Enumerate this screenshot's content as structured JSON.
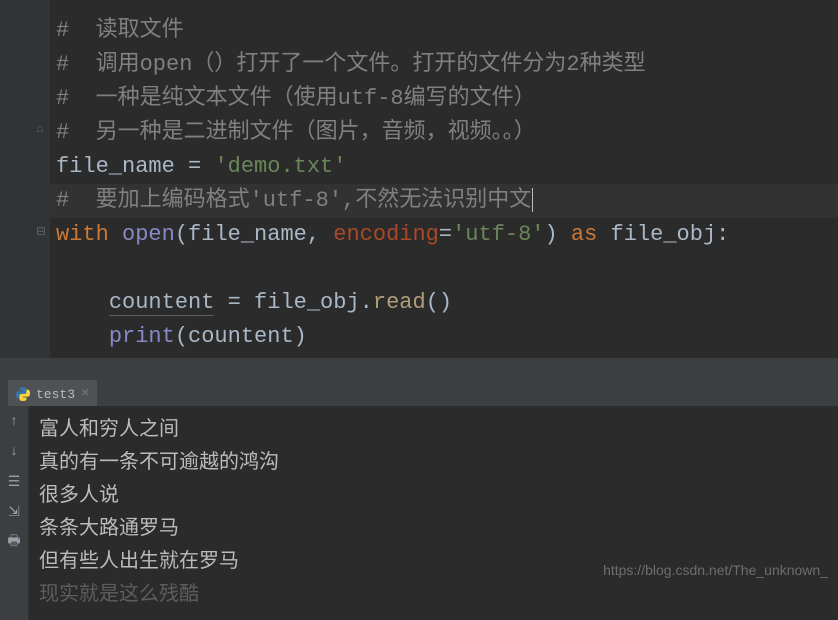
{
  "editor": {
    "lines": {
      "c1": "#  读取文件",
      "c2": "#  调用open（）打开了一个文件。打开的文件分为2种类型",
      "c3": "#  一种是纯文本文件（使用utf-8编写的文件）",
      "c4": "#  另一种是二进制文件（图片，音频，视频。。）",
      "assign_var": "file_name",
      "assign_eq": " = ",
      "assign_str": "'demo.txt'",
      "c5": "#  要加上编码格式'utf-8',不然无法识别中文",
      "with_kw": "with",
      "open_fn": "open",
      "lp": "(",
      "arg1": "file_name",
      "comma": ", ",
      "enc_kw": "encoding",
      "eq": "=",
      "enc_val": "'utf-8'",
      "rp": ")",
      "as_kw": "as",
      "obj": "file_obj",
      "colon": ":",
      "cnt_var": "countent",
      "cnt_eq": " = ",
      "read_obj": "file_obj",
      "dot": ".",
      "read_fn": "read",
      "read_p": "()",
      "print_fn": "print",
      "print_lp": "(",
      "print_arg": "countent",
      "print_rp": ")"
    }
  },
  "run_tab": {
    "label": "test3"
  },
  "console": {
    "l1": "富人和穷人之间",
    "l2": "真的有一条不可逾越的鸿沟",
    "l3": "很多人说",
    "l4": "条条大路通罗马",
    "l5": "但有些人出生就在罗马",
    "l6": "现实就是这么残酷"
  },
  "watermark": "https://blog.csdn.net/The_unknown_"
}
